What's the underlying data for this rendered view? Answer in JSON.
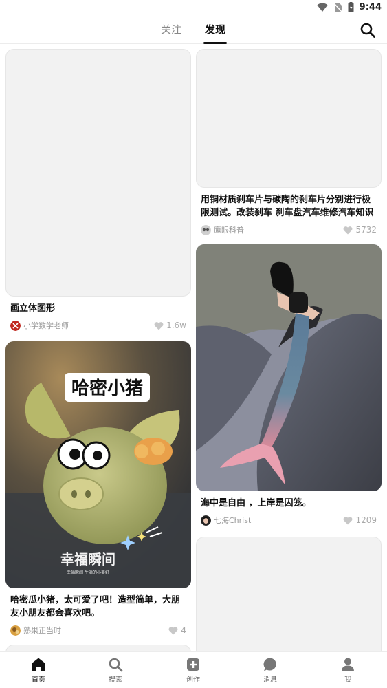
{
  "status_bar": {
    "time": "9:44"
  },
  "header": {
    "tabs": [
      {
        "label": "关注",
        "active": false
      },
      {
        "label": "发现",
        "active": true
      }
    ]
  },
  "feed": {
    "left": [
      {
        "caption": "画立体图形",
        "author": "小学数学老师",
        "likes": "1.6w"
      },
      {
        "caption": "哈密瓜小猪，太可爱了吧！造型简单，大朋友小朋友都会喜欢吧。",
        "author": "熟果正当时",
        "likes": "4",
        "image_text": {
          "title": "哈密小猪",
          "brand": "幸福瞬间",
          "brand_sub": "幸福瞬间 生活的小美好"
        }
      }
    ],
    "right": [
      {
        "caption": "用铜材质刹车片与碳陶的刹车片分别进行极限测试。改装刹车 刹车盘汽车维修汽车知识",
        "author": "鹰眼科普",
        "likes": "5732"
      },
      {
        "caption": "海中是自由 ，上岸是囚笼。",
        "author": "七海Christ",
        "likes": "1209"
      }
    ]
  },
  "bottom_nav": [
    {
      "label": "首页",
      "icon": "home-icon",
      "active": true
    },
    {
      "label": "搜索",
      "icon": "search-icon",
      "active": false
    },
    {
      "label": "创作",
      "icon": "create-plus-icon",
      "active": false
    },
    {
      "label": "消息",
      "icon": "message-icon",
      "active": false
    },
    {
      "label": "我",
      "icon": "profile-icon",
      "active": false
    }
  ],
  "colors": {
    "accent": "#111111",
    "muted": "#999999",
    "placeholder": "#f2f2f2"
  }
}
